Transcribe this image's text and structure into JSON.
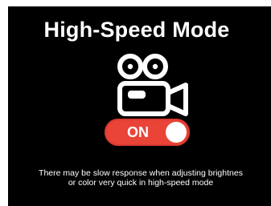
{
  "title": "High-Speed Mode",
  "icon": "video-camera-icon",
  "toggle": {
    "label": "ON",
    "state": "on",
    "color": "#ea4338"
  },
  "notice": {
    "line1": "There may be slow response when adjusting brightnes",
    "line2": "or color very quick in high-speed mode"
  }
}
